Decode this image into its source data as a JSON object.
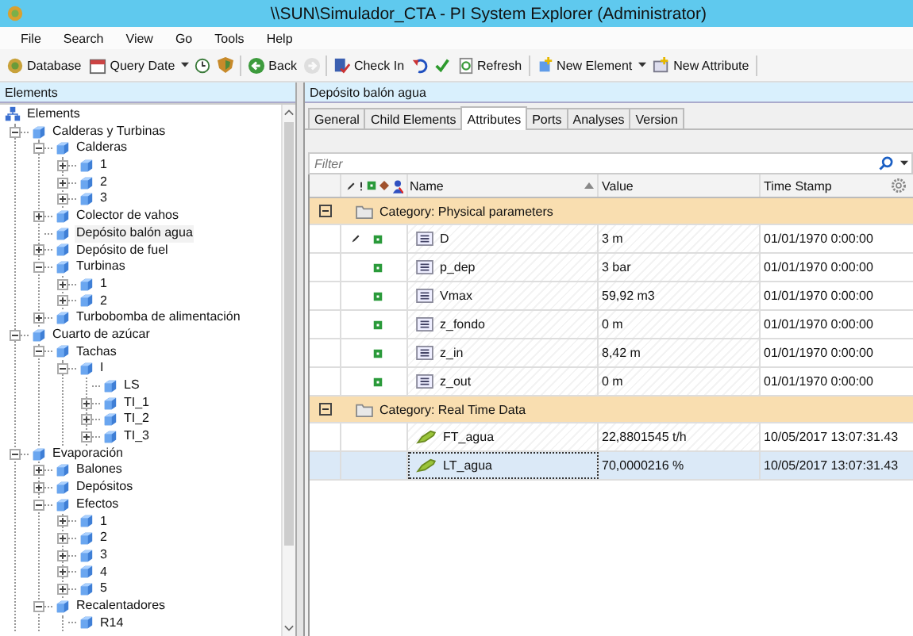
{
  "window": {
    "title": "\\\\SUN\\Simulador_CTA - PI System Explorer (Administrator)"
  },
  "menu": [
    "File",
    "Search",
    "View",
    "Go",
    "Tools",
    "Help"
  ],
  "toolbar": [
    {
      "kind": "db",
      "label": "Database"
    },
    {
      "kind": "calendar",
      "label": "Query Date"
    },
    {
      "kind": "dropdown"
    },
    {
      "kind": "clock"
    },
    {
      "kind": "shield"
    },
    {
      "kind": "sep"
    },
    {
      "kind": "back",
      "label": "Back",
      "disabled": false
    },
    {
      "kind": "forward",
      "disabled": true
    },
    {
      "kind": "sep"
    },
    {
      "kind": "checkin",
      "label": "Check In"
    },
    {
      "kind": "undo"
    },
    {
      "kind": "check"
    },
    {
      "kind": "refresh",
      "label": "Refresh"
    },
    {
      "kind": "sep"
    },
    {
      "kind": "newelement",
      "label": "New Element"
    },
    {
      "kind": "dropdown"
    },
    {
      "kind": "newattribute",
      "label": "New Attribute"
    },
    {
      "kind": "sep"
    }
  ],
  "sidebar": {
    "title": "Elements",
    "root": "Elements",
    "items": [
      {
        "label": "Calderas y Turbinas",
        "expanded": true,
        "selected": false,
        "children": [
          {
            "label": "Calderas",
            "expanded": true,
            "selected": false,
            "children": [
              {
                "label": "1",
                "expanded": false,
                "selected": false
              },
              {
                "label": "2",
                "expanded": false,
                "selected": false
              },
              {
                "label": "3",
                "expanded": false,
                "selected": false
              }
            ]
          },
          {
            "label": "Colector de vahos",
            "expanded": false,
            "selected": false
          },
          {
            "label": "Depósito balón agua",
            "selected": true
          },
          {
            "label": "Depósito de fuel",
            "expanded": false,
            "selected": false
          },
          {
            "label": "Turbinas",
            "expanded": true,
            "selected": false,
            "children": [
              {
                "label": "1",
                "expanded": false,
                "selected": false
              },
              {
                "label": "2",
                "expanded": false,
                "selected": false
              }
            ]
          },
          {
            "label": "Turbobomba de alimentación",
            "expanded": false,
            "selected": false
          }
        ]
      },
      {
        "label": "Cuarto de azúcar",
        "expanded": true,
        "selected": false,
        "children": [
          {
            "label": "Tachas",
            "expanded": true,
            "selected": false,
            "children": [
              {
                "label": "I",
                "expanded": true,
                "selected": false,
                "children": [
                  {
                    "label": "LS",
                    "selected": false
                  },
                  {
                    "label": "TI_1",
                    "expanded": false,
                    "selected": false
                  },
                  {
                    "label": "TI_2",
                    "expanded": false,
                    "selected": false
                  },
                  {
                    "label": "TI_3",
                    "expanded": false,
                    "selected": false
                  }
                ]
              }
            ]
          }
        ]
      },
      {
        "label": "Evaporación",
        "expanded": true,
        "selected": false,
        "children": [
          {
            "label": "Balones",
            "expanded": false,
            "selected": false
          },
          {
            "label": "Depósitos",
            "expanded": false,
            "selected": false
          },
          {
            "label": "Efectos",
            "expanded": true,
            "selected": false,
            "children": [
              {
                "label": "1",
                "expanded": false,
                "selected": false
              },
              {
                "label": "2",
                "expanded": false,
                "selected": false
              },
              {
                "label": "3",
                "expanded": false,
                "selected": false
              },
              {
                "label": "4",
                "expanded": false,
                "selected": false
              },
              {
                "label": "5",
                "expanded": false,
                "selected": false
              }
            ]
          },
          {
            "label": "Recalentadores",
            "expanded": true,
            "selected": false,
            "children": [
              {
                "label": "R14",
                "selected": false
              }
            ]
          }
        ]
      }
    ]
  },
  "detail": {
    "title": "Depósito balón agua",
    "tabs": [
      {
        "label": "General",
        "selected": false
      },
      {
        "label": "Child Elements",
        "selected": false
      },
      {
        "label": "Attributes",
        "selected": true
      },
      {
        "label": "Ports",
        "selected": false
      },
      {
        "label": "Analyses",
        "selected": false
      },
      {
        "label": "Version",
        "selected": false
      }
    ],
    "filter": {
      "placeholder": "Filter"
    },
    "columns": [
      "Name",
      "Value",
      "Time Stamp"
    ],
    "categories": [
      {
        "label": "Category: Physical parameters",
        "expanded": true,
        "rows": [
          {
            "kind": "static",
            "edited": true,
            "selected": false,
            "name": "D",
            "value": "3 m",
            "timestamp": "01/01/1970 0:00:00"
          },
          {
            "kind": "static",
            "edited": false,
            "selected": false,
            "name": "p_dep",
            "value": "3 bar",
            "timestamp": "01/01/1970 0:00:00"
          },
          {
            "kind": "static",
            "edited": false,
            "selected": false,
            "name": "Vmax",
            "value": "59,92 m3",
            "timestamp": "01/01/1970 0:00:00"
          },
          {
            "kind": "static",
            "edited": false,
            "selected": false,
            "name": "z_fondo",
            "value": "0 m",
            "timestamp": "01/01/1970 0:00:00"
          },
          {
            "kind": "static",
            "edited": false,
            "selected": false,
            "name": "z_in",
            "value": "8,42 m",
            "timestamp": "01/01/1970 0:00:00"
          },
          {
            "kind": "static",
            "edited": false,
            "selected": false,
            "name": "z_out",
            "value": "0 m",
            "timestamp": "01/01/1970 0:00:00"
          }
        ]
      },
      {
        "label": "Category: Real Time Data",
        "expanded": true,
        "rows": [
          {
            "kind": "pipoint",
            "edited": false,
            "selected": false,
            "name": "FT_agua",
            "value": "22,8801545 t/h",
            "timestamp": "10/05/2017 13:07:31.43"
          },
          {
            "kind": "pipoint",
            "edited": false,
            "selected": true,
            "name": "LT_agua",
            "value": "70,0000216 %",
            "timestamp": "10/05/2017 13:07:31.43"
          }
        ]
      }
    ]
  }
}
